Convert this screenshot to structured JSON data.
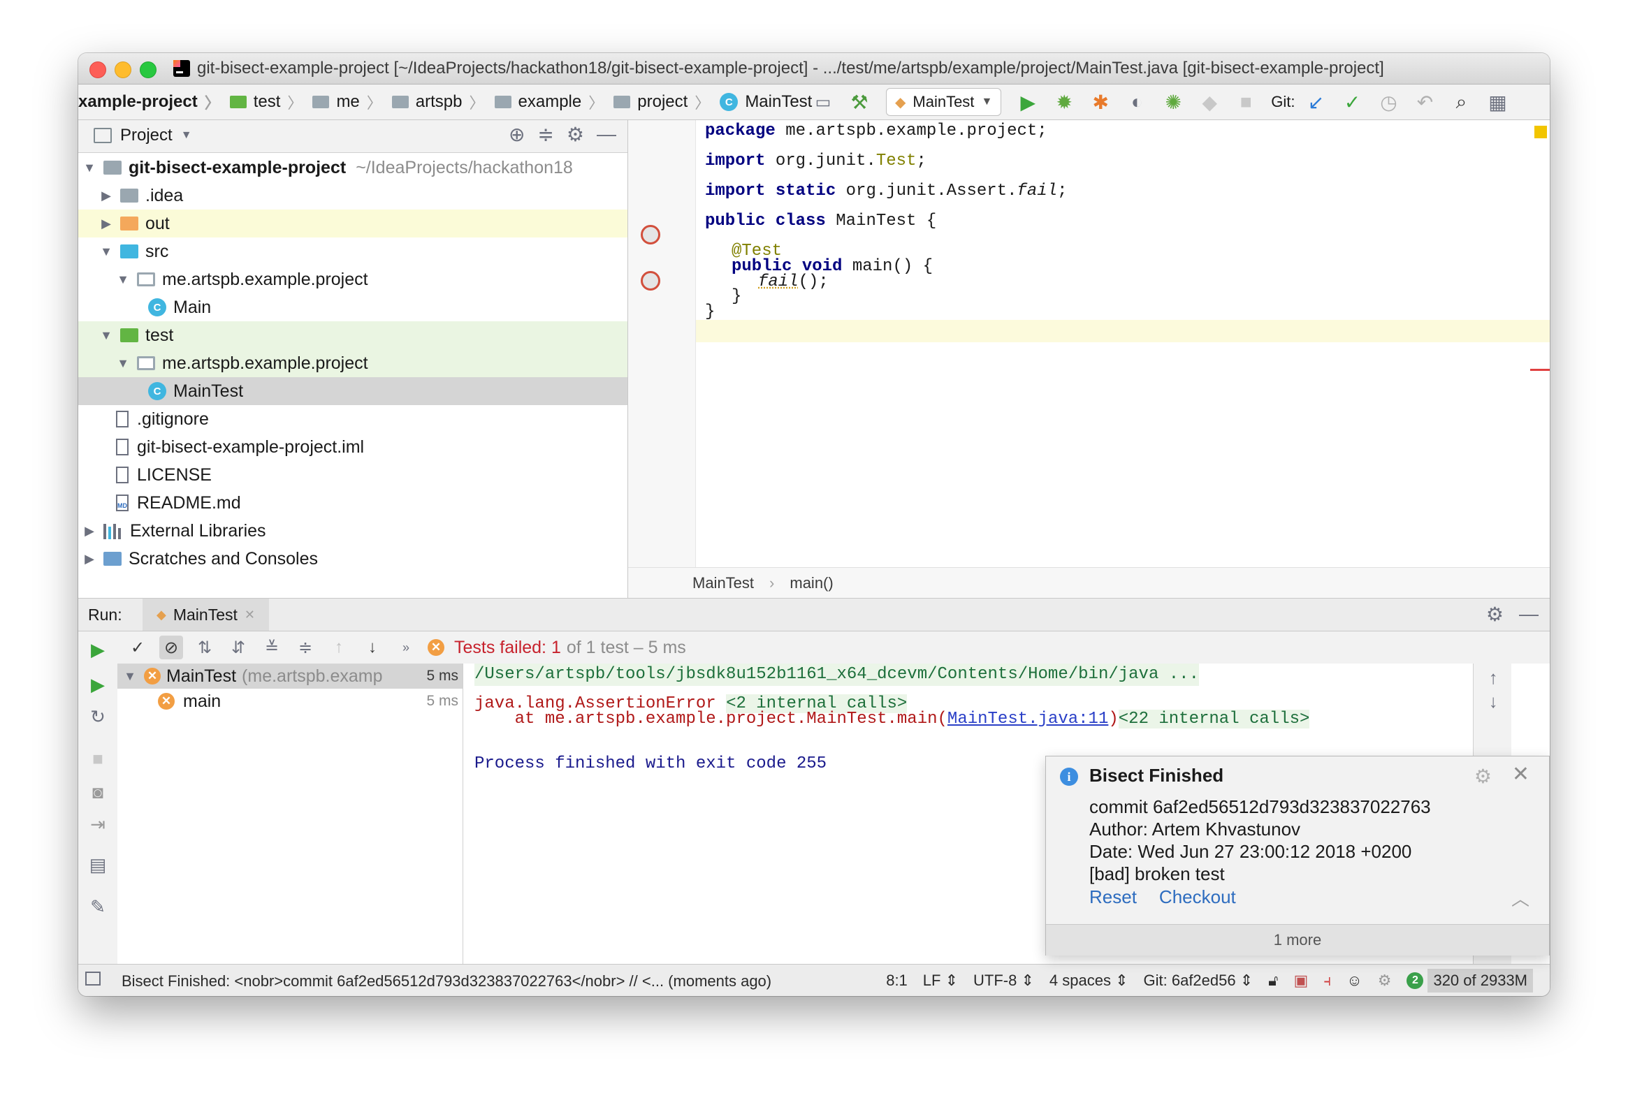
{
  "window": {
    "title": "git-bisect-example-project [~/IdeaProjects/hackathon18/git-bisect-example-project] - .../test/me/artspb/example/project/MainTest.java [git-bisect-example-project]"
  },
  "navbar": {
    "crumbs": [
      "xample-project",
      "test",
      "me",
      "artspb",
      "example",
      "project",
      "MainTest"
    ],
    "run_config": "MainTest",
    "git_label": "Git:"
  },
  "project_panel": {
    "title": "Project",
    "tree": [
      {
        "label": "git-bisect-example-project",
        "hint": "~/IdeaProjects/hackathon18"
      },
      {
        "label": ".idea"
      },
      {
        "label": "out"
      },
      {
        "label": "src"
      },
      {
        "label": "me.artspb.example.project"
      },
      {
        "label": "Main",
        "icon": "C"
      },
      {
        "label": "test"
      },
      {
        "label": "me.artspb.example.project"
      },
      {
        "label": "MainTest",
        "icon": "C"
      },
      {
        "label": ".gitignore"
      },
      {
        "label": "git-bisect-example-project.iml"
      },
      {
        "label": "LICENSE"
      },
      {
        "label": "README.md",
        "icon": "MD"
      },
      {
        "label": "External Libraries"
      },
      {
        "label": "Scratches and Consoles"
      }
    ]
  },
  "editor": {
    "code": {
      "l1_kw": "package",
      "l1_rest": " me.artspb.example.project;",
      "l2_kw": "import",
      "l2_a": " org.junit.",
      "l2_b": "Test",
      "l2_c": ";",
      "l3_kw": "import static",
      "l3_a": " org.junit.Assert.",
      "l3_b": "fail",
      "l3_c": ";",
      "l4_kw": "public class",
      "l4_rest": " MainTest {",
      "l5": "@Test",
      "l6_kw": "public void",
      "l6_rest": " main() {",
      "l7_a": "fail",
      "l7_b": "();",
      "l8": "}",
      "l9": "}"
    },
    "breadcrumb": [
      "MainTest",
      "main()"
    ]
  },
  "run": {
    "label": "Run:",
    "tab": "MainTest",
    "status_failed": "Tests failed: 1",
    "status_meta": "of 1 test – 5 ms",
    "tree": [
      {
        "label": "MainTest",
        "hint": "(me.artspb.examp",
        "time": "5 ms"
      },
      {
        "label": "main",
        "time": "5 ms"
      }
    ],
    "console": {
      "cmd": "/Users/artspb/tools/jbsdk8u152b1161_x64_dcevm/Contents/Home/bin/java ...",
      "err": "java.lang.AssertionError",
      "err_calls": "<2 internal calls>",
      "at_prefix": "    at me.artspb.example.project.MainTest.main(",
      "at_link": "MainTest.java:11",
      "at_suffix": ")",
      "at_calls": "<22 internal calls>",
      "exit": "Process finished with exit code 255"
    }
  },
  "notification": {
    "title": "Bisect Finished",
    "lines": [
      "commit 6af2ed56512d793d323837022763",
      "Author: Artem Khvastunov",
      "Date: Wed Jun 27 23:00:12 2018 +0200",
      "[bad] broken test"
    ],
    "reset": "Reset",
    "checkout": "Checkout",
    "more": "1 more"
  },
  "statusbar": {
    "message": "Bisect Finished: <nobr>commit 6af2ed56512d793d323837022763</nobr> // <... (moments ago)",
    "position": "8:1",
    "line_sep": "LF ⇕",
    "encoding": "UTF-8 ⇕",
    "indent": "4 spaces ⇕",
    "git": "Git: 6af2ed56 ⇕",
    "badge": "2",
    "memory": "320 of 2933M"
  }
}
